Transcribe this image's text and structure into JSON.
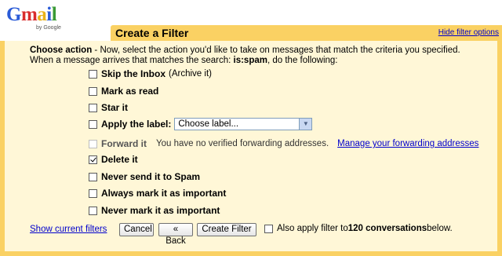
{
  "logo": {
    "wordmark": "Gmail",
    "byline": "by Google"
  },
  "header": {
    "title": "Create a Filter",
    "hide_link": "Hide filter options"
  },
  "intro": {
    "line1_bold": "Choose action",
    "line1_rest": " - Now, select the action you'd like to take on messages that match the criteria you specified.",
    "line2_prefix": "When a message arrives that matches the search: ",
    "line2_query": "is:spam",
    "line2_suffix": ", do the following:"
  },
  "options": {
    "skip_inbox": {
      "label": "Skip the Inbox",
      "note": "(Archive it)",
      "checked": false
    },
    "mark_read": {
      "label": "Mark as read",
      "checked": false
    },
    "star": {
      "label": "Star it",
      "checked": false
    },
    "apply_label": {
      "label": "Apply the label:",
      "select_value": "Choose label...",
      "checked": false
    },
    "forward": {
      "label": "Forward it",
      "note": "You have no verified forwarding addresses.",
      "link": "Manage your forwarding addresses",
      "checked": false,
      "disabled": true
    },
    "delete": {
      "label": "Delete it",
      "checked": true
    },
    "never_spam": {
      "label": "Never send it to Spam",
      "checked": false
    },
    "always_important": {
      "label": "Always mark it as important",
      "checked": false
    },
    "never_important": {
      "label": "Never mark it as important",
      "checked": false
    }
  },
  "footer": {
    "show_filters": "Show current filters",
    "cancel": "Cancel",
    "back": "« Back",
    "create": "Create Filter",
    "apply_prefix": "Also apply filter to ",
    "apply_count": "120 conversations",
    "apply_suffix": " below."
  },
  "colors": {
    "header_bg": "#fad163",
    "panel_bg": "#fff7d7",
    "link": "#0000cc"
  }
}
